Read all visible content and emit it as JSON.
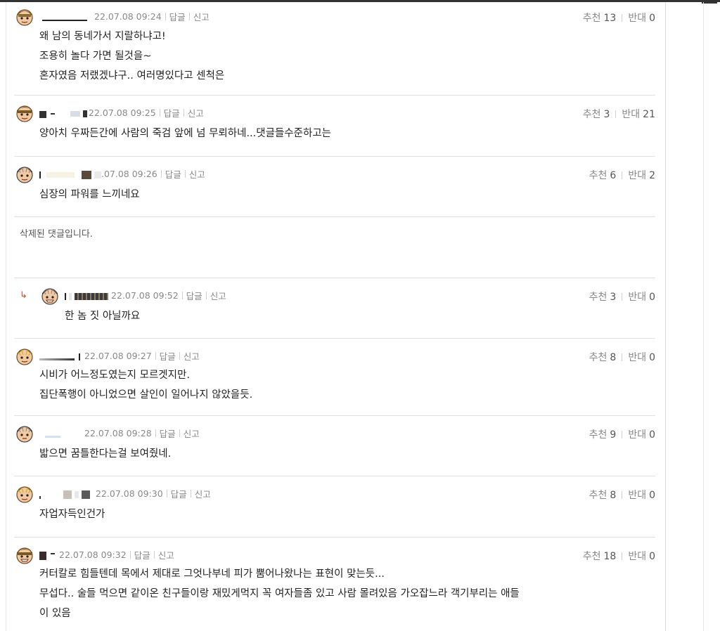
{
  "comments": [
    {
      "timestamp": "22.07.08 09:24",
      "reply_label": "답글",
      "report_label": "신고",
      "up_label": "추천",
      "up_count": "13",
      "down_label": "반대",
      "down_count": "0",
      "lines": [
        "왜 남의 동네가서 지랄하냐고!",
        "조용히 놀다 가면 될것을~",
        "혼자였음 저랬겠냐구.. 여러명있다고 센척은"
      ]
    },
    {
      "timestamp": "22.07.08 09:25",
      "reply_label": "답글",
      "report_label": "신고",
      "up_label": "추천",
      "up_count": "3",
      "down_label": "반대",
      "down_count": "21",
      "lines": [
        "양아치 우짜든간에 사람의 죽검 앞에 넘 무뢰하네...댓글들수준하고는"
      ]
    },
    {
      "timestamp": ".07.08 09:26",
      "reply_label": "답글",
      "report_label": "신고",
      "up_label": "추천",
      "up_count": "6",
      "down_label": "반대",
      "down_count": "2",
      "lines": [
        "심장의 파워를 느끼네요"
      ]
    },
    {
      "deleted_text": "삭제된 댓글입니다."
    },
    {
      "timestamp": "22.07.08 09:52",
      "reply_label": "답글",
      "report_label": "신고",
      "up_label": "추천",
      "up_count": "3",
      "down_label": "반대",
      "down_count": "0",
      "lines": [
        "한 놈 짓 아닐까요"
      ]
    },
    {
      "timestamp": "22.07.08 09:27",
      "reply_label": "답글",
      "report_label": "신고",
      "up_label": "추천",
      "up_count": "8",
      "down_label": "반대",
      "down_count": "0",
      "lines": [
        "시비가 어느정도였는지 모르겟지만.",
        "집단폭행이 아니었으면 살인이 일어나지 않았을듯."
      ]
    },
    {
      "timestamp": "22.07.08 09:28",
      "reply_label": "답글",
      "report_label": "신고",
      "up_label": "추천",
      "up_count": "9",
      "down_label": "반대",
      "down_count": "0",
      "lines": [
        "밟으면 꿈틀한다는걸 보여줬네."
      ]
    },
    {
      "timestamp": "22.07.08 09:30",
      "reply_label": "답글",
      "report_label": "신고",
      "up_label": "추천",
      "up_count": "8",
      "down_label": "반대",
      "down_count": "0",
      "lines": [
        "자업자득인건가"
      ]
    },
    {
      "timestamp": "22.07.08 09:32",
      "reply_label": "답글",
      "report_label": "신고",
      "up_label": "추천",
      "up_count": "18",
      "down_label": "반대",
      "down_count": "0",
      "lines": [
        "커터칼로 힘들텐데 목에서 제대로 그엇나부네 피가 뿜어나왔나는 표현이 맞는듯...",
        "무섭다.. 술들 먹으면 같이온 친구들이랑 재밌게먹지 꼭 여자들좀 있고 사람 몰려있음 가오잡느라 객기부리는 애들",
        "이 있음"
      ]
    }
  ],
  "reply_arrow_glyph": "↳",
  "colors": {
    "meta_text": "#888888",
    "body_text": "#222222",
    "divider": "#e0e0e0",
    "reply_arrow": "#d04a3a"
  }
}
